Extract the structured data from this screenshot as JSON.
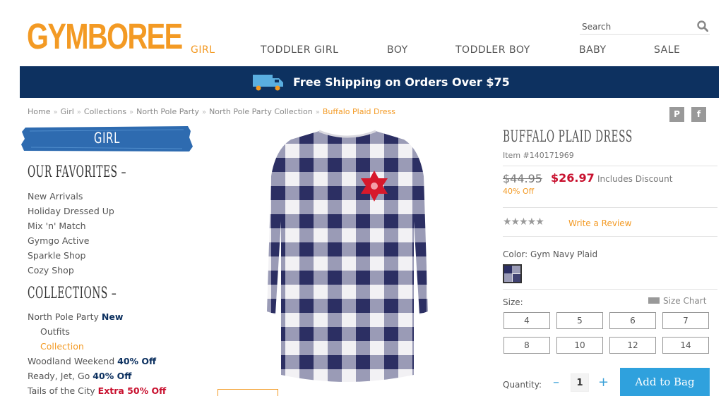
{
  "brand": {
    "logo": "GYMBOREE"
  },
  "search": {
    "placeholder": "Search"
  },
  "nav": {
    "items": [
      "GIRL",
      "TODDLER GIRL",
      "BOY",
      "TODDLER BOY",
      "BABY",
      "SALE"
    ],
    "active": "GIRL"
  },
  "promo": {
    "text": "Free Shipping on Orders Over $75"
  },
  "breadcrumb": {
    "items": [
      "Home",
      "Girl",
      "Collections",
      "North Pole Party",
      "North Pole Party Collection"
    ],
    "current": "Buffalo Plaid Dress",
    "separator": "»"
  },
  "social": {
    "pinterest": "P",
    "facebook": "f"
  },
  "sidebar": {
    "banner": "GIRL",
    "favorites_heading": "OUR FAVORITES –",
    "favorites": [
      "New Arrivals",
      "Holiday Dressed Up",
      "Mix 'n' Match",
      "Gymgo Active",
      "Sparkle Shop",
      "Cozy Shop"
    ],
    "collections_heading": "COLLECTIONS –",
    "collections": [
      {
        "label": "North Pole Party",
        "badge": "New"
      },
      {
        "label": "Outfits"
      },
      {
        "label": "Collection"
      },
      {
        "label": "Woodland Weekend",
        "badge": "40% Off"
      },
      {
        "label": "Ready, Jet, Go",
        "badge": "40% Off"
      },
      {
        "label": "Tails of the City",
        "badge": "Extra 50% Off"
      }
    ]
  },
  "product": {
    "title": "BUFFALO PLAID DRESS",
    "item_number": "Item #140171969",
    "price_original": "$44.95",
    "price_sale": "$26.97",
    "price_note": "Includes Discount",
    "discount": "40% Off",
    "stars": "★★★★★",
    "review_link": "Write a Review",
    "color_label": "Color: Gym Navy Plaid",
    "size_label": "Size:",
    "size_chart": "Size Chart",
    "sizes": [
      "4",
      "5",
      "6",
      "7",
      "8",
      "10",
      "12",
      "14"
    ],
    "quantity_label": "Quantity:",
    "quantity": "1",
    "qty_minus": "–",
    "qty_plus": "+",
    "add_button": "Add to Bag"
  },
  "colors": {
    "brand_orange": "#f39a24",
    "navy": "#0d3160",
    "sale_red": "#c8102e",
    "button_blue": "#2fa1dd"
  }
}
